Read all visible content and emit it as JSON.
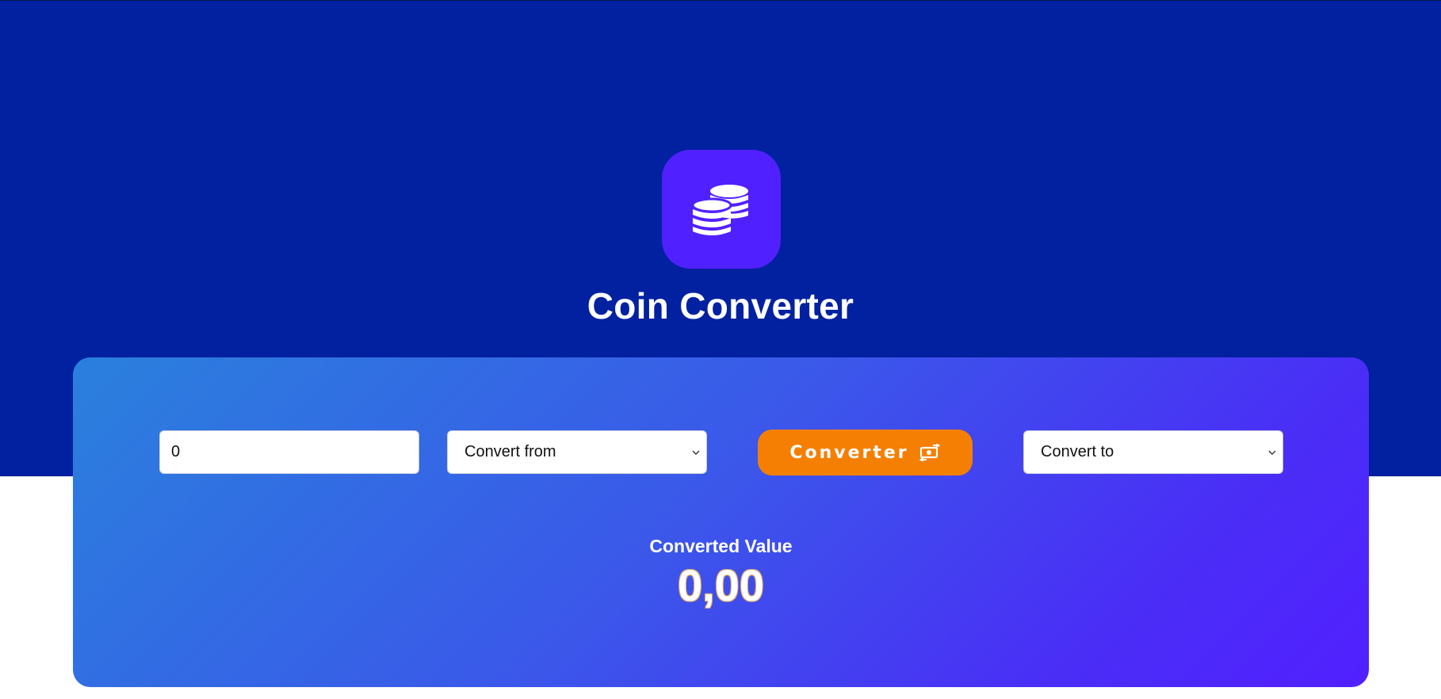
{
  "app": {
    "title": "Coin Converter",
    "logo_icon": "coins-icon"
  },
  "converter": {
    "amount_value": "0",
    "from_select": {
      "selected": "Convert from"
    },
    "to_select": {
      "selected": "Convert to"
    },
    "button": {
      "label": "Converter",
      "icon": "money-exchange-icon"
    }
  },
  "result": {
    "label": "Converted Value",
    "value": "0,00"
  },
  "colors": {
    "hero_background": "#0121a0",
    "logo_tile": "#5120ff",
    "card_gradient_start": "#2a80dd",
    "card_gradient_end": "#5120ff",
    "button": "#f57f02",
    "page_background": "#ffffff"
  }
}
